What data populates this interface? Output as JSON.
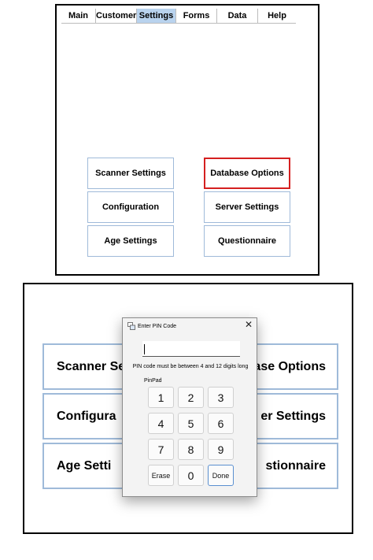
{
  "top_panel": {
    "menu": [
      "Main",
      "Customer",
      "Settings",
      "Forms",
      "Data",
      "Help"
    ],
    "active_menu": "Settings",
    "buttons": {
      "scanner_settings": "Scanner Settings",
      "database_options": "Database Options",
      "configuration": "Configuration",
      "server_settings": "Server Settings",
      "age_settings": "Age Settings",
      "questionnaire": "Questionnaire"
    }
  },
  "bottom_panel": {
    "visible_button_text": {
      "scanner_settings": "Scanner Set",
      "database_options": "ase Options",
      "configuration": "Configura",
      "server_settings": "er Settings",
      "age_settings": "Age Setti",
      "questionnaire": "stionnaire"
    }
  },
  "pin_dialog": {
    "title": "Enter PIN Code",
    "close_glyph": "✕",
    "pin_value": "",
    "note": "PIN code must be between 4 and 12 digits long",
    "pinpad_label": "PinPad",
    "keys": [
      "1",
      "2",
      "3",
      "4",
      "5",
      "6",
      "7",
      "8",
      "9"
    ],
    "erase_label": "Erase",
    "zero_label": "0",
    "done_label": "Done"
  },
  "colors": {
    "menu_active": "#b9d3ee",
    "button_border": "#9fbad9",
    "highlight_border": "#d52020"
  },
  "icons": {
    "dialog": "window-icon",
    "close": "close-icon"
  }
}
